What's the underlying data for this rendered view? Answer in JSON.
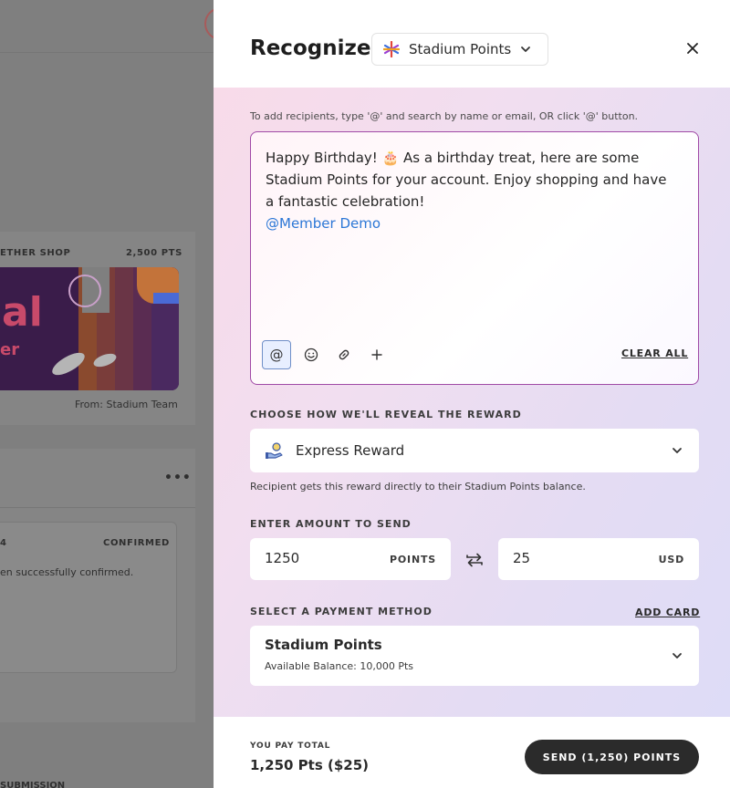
{
  "background": {
    "card_label": "ETHER SHOP",
    "card_points": "2,500 PTS",
    "card_image_big": "al",
    "card_image_small": "er",
    "card_from": "From: Stadium Team",
    "more_menu": "•••",
    "activity_number": "4",
    "activity_status": "CONFIRMED",
    "activity_message": "en successfully confirmed.",
    "bottom_text": "SUBMISSION"
  },
  "drawer": {
    "title": "Recognize",
    "currency": {
      "label": "Stadium Points",
      "icon": "sparkle-star-icon"
    },
    "close_icon": "close-icon"
  },
  "message": {
    "hint": "To add recipients, type '@' and search by name or email, OR click '@' button.",
    "text": "Happy Birthday! 🎂 As a birthday treat, here are some Stadium Points for your account. Enjoy shopping and have a fantastic celebration!",
    "mention": "@Member Demo",
    "toolbar": {
      "at_label": "@",
      "emoji_icon": "smile-icon",
      "link_icon": "link-icon",
      "add_icon": "plus-icon"
    },
    "clear_all": "CLEAR ALL"
  },
  "reveal": {
    "label": "CHOOSE HOW WE'LL REVEAL THE REWARD",
    "selected": "Express Reward",
    "icon": "hand-coin-icon",
    "note": "Recipient gets this reward directly to their Stadium Points balance."
  },
  "amount": {
    "label": "ENTER AMOUNT TO SEND",
    "points_value": "1250",
    "points_unit": "POINTS",
    "usd_value": "25",
    "usd_unit": "USD",
    "swap_icon": "swap-arrows-icon"
  },
  "payment": {
    "label": "SELECT A PAYMENT METHOD",
    "add_card": "ADD CARD",
    "method_name": "Stadium Points",
    "balance": "Available Balance: 10,000 Pts"
  },
  "footer": {
    "total_label": "YOU PAY TOTAL",
    "total_value": "1,250 Pts ($25)",
    "send_label": "SEND (1,250) POINTS"
  },
  "colors": {
    "accent_border": "#a04aa6",
    "mention": "#2c77d6",
    "send_button": "#2b2b2b"
  }
}
